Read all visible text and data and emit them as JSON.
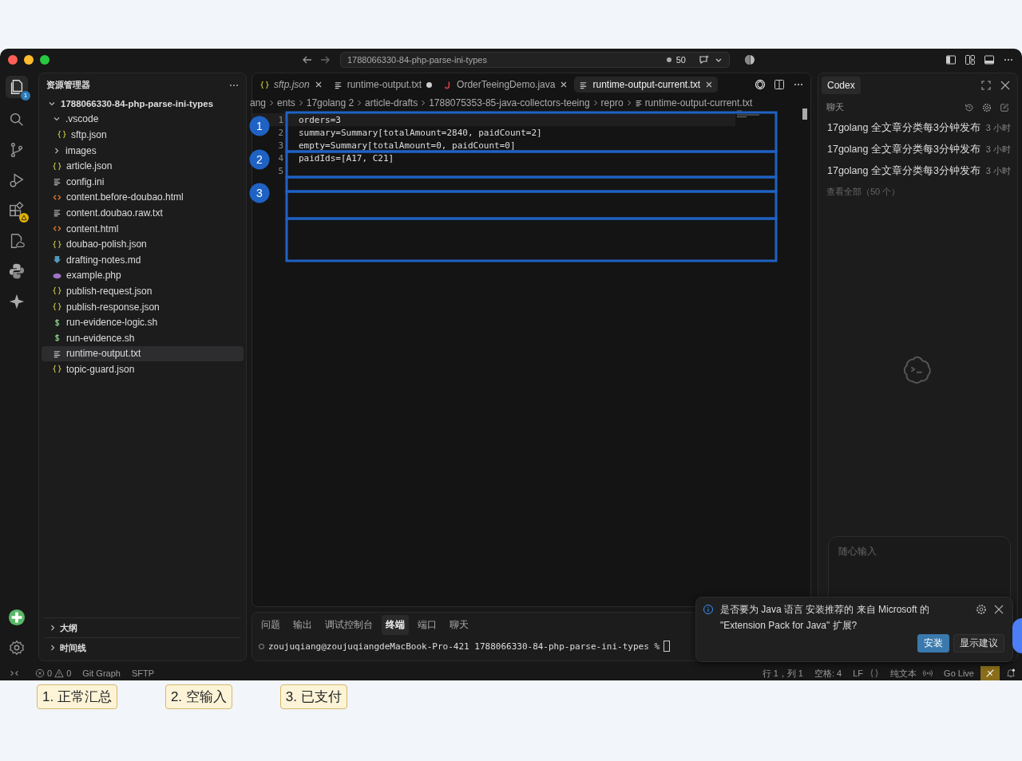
{
  "window": {
    "command_center": "1788066330-84-php-parse-ini-types",
    "sync_count": "50"
  },
  "activity_bar": {
    "explorer_badge": "1",
    "extensions_warning": true
  },
  "explorer": {
    "title": "资源管理器",
    "tree": [
      {
        "label": "1788066330-84-php-parse-ini-types",
        "kind": "folder",
        "expanded": true,
        "selected": false,
        "children": [
          {
            "label": ".vscode",
            "kind": "folder",
            "expanded": true,
            "selected": false,
            "children": [
              {
                "label": "sftp.json",
                "kind": "json",
                "selected": false
              }
            ]
          },
          {
            "label": "images",
            "kind": "folder",
            "expanded": false,
            "selected": false
          },
          {
            "label": "article.json",
            "kind": "json",
            "selected": false
          },
          {
            "label": "config.ini",
            "kind": "txt",
            "selected": false
          },
          {
            "label": "content.before-doubao.html",
            "kind": "html",
            "selected": false
          },
          {
            "label": "content.doubao.raw.txt",
            "kind": "txt",
            "selected": false
          },
          {
            "label": "content.html",
            "kind": "html",
            "selected": false
          },
          {
            "label": "doubao-polish.json",
            "kind": "json",
            "selected": false
          },
          {
            "label": "drafting-notes.md",
            "kind": "md",
            "selected": false
          },
          {
            "label": "example.php",
            "kind": "php",
            "selected": false
          },
          {
            "label": "publish-request.json",
            "kind": "json",
            "selected": false
          },
          {
            "label": "publish-response.json",
            "kind": "json",
            "selected": false
          },
          {
            "label": "run-evidence-logic.sh",
            "kind": "sh",
            "selected": false
          },
          {
            "label": "run-evidence.sh",
            "kind": "sh",
            "selected": false
          },
          {
            "label": "runtime-output.txt",
            "kind": "txt",
            "selected": true
          },
          {
            "label": "topic-guard.json",
            "kind": "json",
            "selected": false
          }
        ]
      }
    ],
    "sections": [
      {
        "label": "大纲",
        "expanded": false
      },
      {
        "label": "时间线",
        "expanded": false
      }
    ]
  },
  "editor": {
    "tabs": [
      {
        "label": "sftp.json",
        "kind": "json",
        "selected": false,
        "modified": false,
        "preview": true
      },
      {
        "label": "runtime-output.txt",
        "kind": "txt",
        "selected": false,
        "modified": true,
        "preview": false
      },
      {
        "label": "OrderTeeingDemo.java",
        "kind": "java",
        "selected": false,
        "modified": false,
        "preview": false
      },
      {
        "label": "runtime-output-current.txt",
        "kind": "txt",
        "selected": true,
        "modified": false,
        "preview": false
      }
    ],
    "breadcrumb": [
      "ang",
      "ents",
      "17golang 2",
      "article-drafts",
      "1788075353-85-java-collectors-teeing",
      "repro",
      "runtime-output-current.txt"
    ],
    "lines": [
      {
        "number": "1",
        "text": "orders=3",
        "current": true
      },
      {
        "number": "2",
        "text": "summary=Summary[totalAmount=2840, paidCount=2]",
        "current": false
      },
      {
        "number": "3",
        "text": "empty=Summary[totalAmount=0, paidCount=0]",
        "current": false
      },
      {
        "number": "4",
        "text": "paidIds=[A17, C21]",
        "current": false
      },
      {
        "number": "5",
        "current": false
      }
    ]
  },
  "panel": {
    "tabs": [
      {
        "label": "问题",
        "selected": false
      },
      {
        "label": "输出",
        "selected": false
      },
      {
        "label": "调试控制台",
        "selected": false
      },
      {
        "label": "终端",
        "selected": true
      },
      {
        "label": "端口",
        "selected": false
      },
      {
        "label": "聊天",
        "selected": false
      }
    ],
    "prompt": "zoujuqiang@zoujuqiangdeMacBook-Pro-421 1788066330-84-php-parse-ini-types %"
  },
  "codex": {
    "tab": "Codex",
    "section": "聊天",
    "threads": [
      {
        "title": "17golang 全文章分类每3分钟发布",
        "time": "3 小时"
      },
      {
        "title": "17golang 全文章分类每3分钟发布",
        "time": "3 小时"
      },
      {
        "title": "17golang 全文章分类每3分钟发布",
        "time": "3 小时"
      }
    ],
    "view_all": "查看全部（50 个）",
    "input_placeholder": "随心输入"
  },
  "notification": {
    "message": "是否要为 Java 语言 安装推荐的 来自 Microsoft 的 \"Extension Pack for Java\" 扩展?",
    "buttons": [
      {
        "label": "安装",
        "primary": true
      },
      {
        "label": "显示建议",
        "primary": false
      }
    ]
  },
  "status_bar": {
    "errors": "0",
    "warnings": "0",
    "left_items": [
      "Git Graph",
      "SFTP"
    ],
    "right_items": [
      "行 1，列 1",
      "空格: 4",
      "LF"
    ],
    "language": "纯文本",
    "go_live": "Go Live"
  },
  "annotations": {
    "markers": [
      "1",
      "2",
      "3"
    ],
    "captions": [
      "1. 正常汇总",
      "2. 空输入",
      "3. 已支付"
    ]
  }
}
